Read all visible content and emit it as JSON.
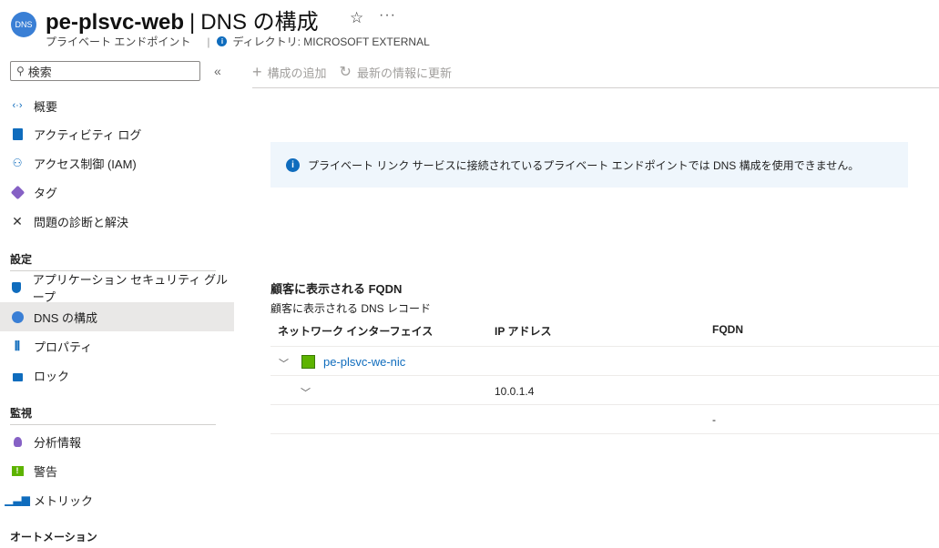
{
  "header": {
    "icon_text": "DNS",
    "resource_name": "pe-plsvc-web",
    "separator": "|",
    "page_title": "DNS の構成",
    "resource_type": "プライベート エンドポイント",
    "directory": "ディレクトリ: MICROSOFT EXTERNAL"
  },
  "sidebar": {
    "search_placeholder": "検索",
    "collapse_glyph": "«",
    "items": [
      {
        "label": "概要"
      },
      {
        "label": "アクティビティ ログ"
      },
      {
        "label": "アクセス制御 (IAM)"
      },
      {
        "label": "タグ"
      },
      {
        "label": "問題の診断と解決"
      }
    ],
    "sections": [
      {
        "title": "設定",
        "items": [
          {
            "label": "アプリケーション セキュリティ グループ"
          },
          {
            "label": "DNS の構成",
            "selected": true
          },
          {
            "label": "プロパティ"
          },
          {
            "label": "ロック"
          }
        ]
      },
      {
        "title": "監視",
        "items": [
          {
            "label": "分析情報"
          },
          {
            "label": "警告"
          },
          {
            "label": "メトリック"
          }
        ]
      },
      {
        "title": "オートメーション",
        "items": []
      }
    ]
  },
  "toolbar": {
    "add_label": "構成の追加",
    "refresh_label": "最新の情報に更新"
  },
  "banner": {
    "message": "プライベート リンク サービスに接続されているプライベート エンドポイントでは DNS 構成を使用できません。"
  },
  "fqdn": {
    "title": "顧客に表示される FQDN",
    "subtitle": "顧客に表示される DNS レコード",
    "columns": [
      "ネットワーク インターフェイス",
      "IP アドレス",
      "FQDN"
    ],
    "nic_name": "pe-plsvc-we-nic",
    "ip_address": "10.0.1.4",
    "fqdn_value": "-"
  },
  "colors": {
    "accent": "#0f6cbd",
    "selected_bg": "#e9e8e7",
    "banner_bg": "#eff6fc"
  }
}
